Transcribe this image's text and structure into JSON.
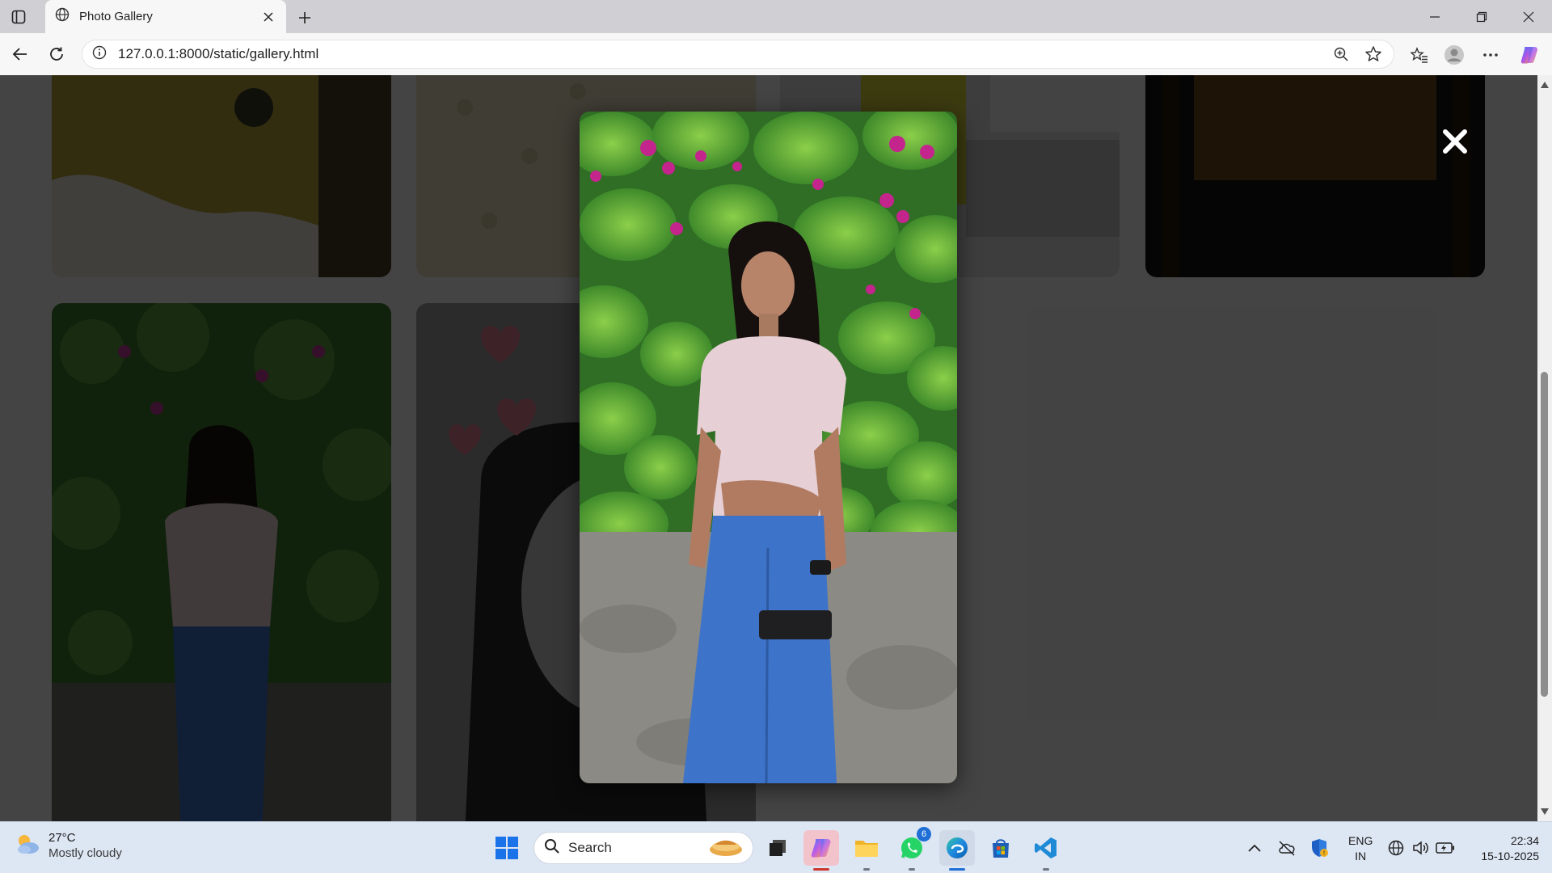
{
  "browser": {
    "tab_title": "Photo Gallery",
    "url": "127.0.0.1:8000/static/gallery.html"
  },
  "icons": {
    "tab_favicon": "globe-icon",
    "new_tab": "plus-icon",
    "back": "back-arrow-icon",
    "reload": "reload-icon",
    "site_info": "info-icon",
    "zoom": "zoom-icon",
    "favorite": "star-icon",
    "favorites_list": "favorites-icon",
    "profile": "profile-avatar-icon",
    "menu": "more-dots-icon",
    "copilot": "copilot-icon",
    "close_modal": "close-x-icon"
  },
  "gallery": {
    "modal_open": true,
    "close_symbol": "✖",
    "card_count_visible": 6
  },
  "taskbar": {
    "weather_temp": "27°C",
    "weather_condition": "Mostly cloudy",
    "search_placeholder": "Search",
    "whatsapp_badge": "6",
    "language_line1": "ENG",
    "language_line2": "IN",
    "time": "22:34",
    "date": "15-10-2025"
  },
  "colors": {
    "overlay": "rgba(0,0,0,0.72)",
    "chrome_bg": "#f7f7f7",
    "titlebar_bg": "#cfcfd4",
    "taskbar_bg": "#dde6f3",
    "accent": "#1f6fd6"
  }
}
